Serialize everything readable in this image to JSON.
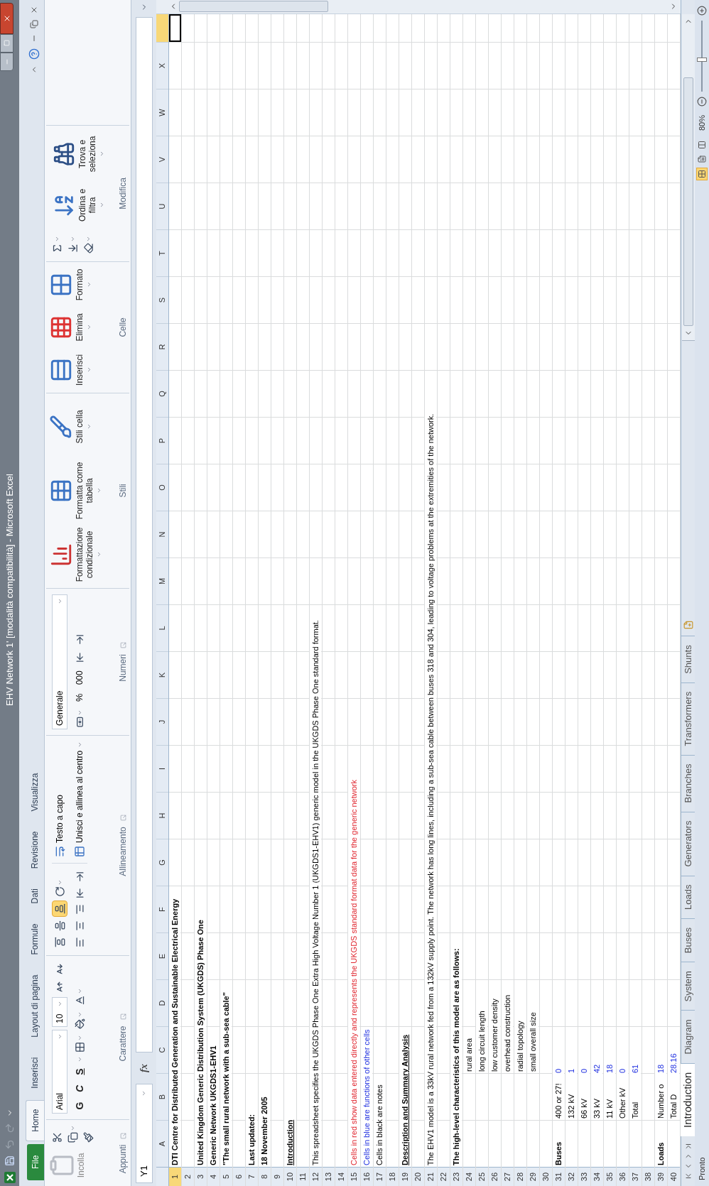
{
  "window": {
    "title": "EHV Network 1' [modalità compatibilità] - Microsoft Excel"
  },
  "menu_tabs": [
    {
      "label": "File",
      "kind": "file",
      "selected": false
    },
    {
      "label": "Home",
      "kind": "tab",
      "selected": true
    },
    {
      "label": "Inserisci",
      "kind": "tab",
      "selected": false
    },
    {
      "label": "Layout di pagina",
      "kind": "tab",
      "selected": false
    },
    {
      "label": "Formule",
      "kind": "tab",
      "selected": false
    },
    {
      "label": "Dati",
      "kind": "tab",
      "selected": false
    },
    {
      "label": "Revisione",
      "kind": "tab",
      "selected": false
    },
    {
      "label": "Visualizza",
      "kind": "tab",
      "selected": false
    }
  ],
  "ribbon": {
    "groups": [
      {
        "kind": "clipboard",
        "label": "Appunti",
        "paste": "Incolla"
      },
      {
        "kind": "font",
        "label": "Carattere",
        "font": "Arial",
        "size": "10",
        "styles": [
          "G",
          "C",
          "S"
        ]
      },
      {
        "kind": "alignment",
        "label": "Allineamento",
        "wrap": "Testo a capo",
        "merge": "Unisci e allinea al centro",
        "vertical": [
          {
            "selected": false
          },
          {
            "selected": false
          },
          {
            "selected": true
          }
        ]
      },
      {
        "kind": "number",
        "label": "Numeri",
        "format": "Generale",
        "percent": "%",
        "thousands": "000"
      },
      {
        "kind": "large",
        "label": "Stili",
        "buttons": [
          {
            "label": "Formattazione condizionale"
          },
          {
            "label": "Formatta come tabella"
          },
          {
            "label": "Stili cella"
          }
        ]
      },
      {
        "kind": "large",
        "label": "Celle",
        "buttons": [
          {
            "label": "Inserisci"
          },
          {
            "label": "Elimina"
          },
          {
            "label": "Formato"
          }
        ]
      },
      {
        "kind": "editing",
        "label": "Modifica",
        "buttons": [
          {
            "label": "Ordina e filtra"
          },
          {
            "label": "Trova e seleziona"
          }
        ]
      }
    ]
  },
  "formula_bar": {
    "name_box": "Y1",
    "function_label": "fx"
  },
  "sheet": {
    "columns": [
      {
        "label": "A"
      },
      {
        "label": "B"
      },
      {
        "label": "C"
      },
      {
        "label": "D"
      },
      {
        "label": "E"
      },
      {
        "label": "F"
      },
      {
        "label": "G"
      },
      {
        "label": "H"
      },
      {
        "label": "I"
      },
      {
        "label": "J"
      },
      {
        "label": "K"
      },
      {
        "label": "L"
      },
      {
        "label": "M"
      },
      {
        "label": "N"
      },
      {
        "label": "O"
      },
      {
        "label": "P"
      },
      {
        "label": "Q"
      },
      {
        "label": "R"
      },
      {
        "label": "S"
      },
      {
        "label": "T"
      },
      {
        "label": "U"
      },
      {
        "label": "V"
      },
      {
        "label": "W"
      },
      {
        "label": "X"
      }
    ],
    "partial_column_selected": true,
    "rows": [
      {
        "number": "1",
        "selected": true,
        "A": {
          "text": "DTI Centre for Distributed Generation and Sustainable Electrical Energy",
          "kind": "bold"
        }
      },
      {
        "number": "2",
        "selected": false
      },
      {
        "number": "3",
        "selected": false,
        "A": {
          "text": "United Kingdom Generic Distribution System (UKGDS) Phase One",
          "kind": "bold"
        }
      },
      {
        "number": "4",
        "selected": false,
        "A": {
          "text": "Generic Network UKGDS1-EHV1",
          "kind": "bold"
        }
      },
      {
        "number": "5",
        "selected": false,
        "A": {
          "text": "\"The small rural network with a sub-sea cable\"",
          "kind": "bold"
        }
      },
      {
        "number": "6",
        "selected": false
      },
      {
        "number": "7",
        "selected": false,
        "A": {
          "text": "Last updated:",
          "kind": "bold"
        }
      },
      {
        "number": "8",
        "selected": false,
        "A": {
          "text": "18 November 2005",
          "kind": "bold"
        }
      },
      {
        "number": "9",
        "selected": false
      },
      {
        "number": "10",
        "selected": false,
        "A": {
          "text": "Introduction",
          "kind": "heading"
        }
      },
      {
        "number": "11",
        "selected": false
      },
      {
        "number": "12",
        "selected": false,
        "A": {
          "text": "This spreadsheet specifies the UKGDS Phase One Extra High Voltage Number 1 (UKGDS1-EHV1) generic model in the UKGDS Phase One standard format.",
          "kind": "note"
        }
      },
      {
        "number": "13",
        "selected": false
      },
      {
        "number": "14",
        "selected": false
      },
      {
        "number": "15",
        "selected": false,
        "A": {
          "text": "Cells in red show data entered directly and represents the UKGDS standard format data for the generic network",
          "kind": "input"
        }
      },
      {
        "number": "16",
        "selected": false,
        "A": {
          "text": "Cells in blue are functions of other cells",
          "kind": "formula"
        }
      },
      {
        "number": "17",
        "selected": false,
        "A": {
          "text": "Cells in black are notes",
          "kind": "note"
        }
      },
      {
        "number": "18",
        "selected": false
      },
      {
        "number": "19",
        "selected": false,
        "A": {
          "text": "Description and Summary Analysis",
          "kind": "heading"
        }
      },
      {
        "number": "20",
        "selected": false
      },
      {
        "number": "21",
        "selected": false,
        "A": {
          "text": "The EHV1 model is a 33kV rural network fed from a 132kV supply point.  The network has long lines, including a sub-sea cable between buses 318 and 304, leading to voltage problems at the extremities of the network.",
          "kind": "note"
        }
      },
      {
        "number": "22",
        "selected": false
      },
      {
        "number": "23",
        "selected": false,
        "A": {
          "text": "The high-level characteristics of this model are as follows:",
          "kind": "bold"
        }
      },
      {
        "number": "24",
        "selected": false,
        "C": {
          "text": "rural area",
          "kind": "note"
        }
      },
      {
        "number": "25",
        "selected": false,
        "C": {
          "text": "long circuit length",
          "kind": "note"
        }
      },
      {
        "number": "26",
        "selected": false,
        "C": {
          "text": "low customer density",
          "kind": "note"
        }
      },
      {
        "number": "27",
        "selected": false,
        "C": {
          "text": "overhead construction",
          "kind": "note"
        }
      },
      {
        "number": "28",
        "selected": false,
        "C": {
          "text": "radial topology",
          "kind": "note"
        }
      },
      {
        "number": "29",
        "selected": false,
        "C": {
          "text": "small overall size",
          "kind": "note"
        }
      },
      {
        "number": "30",
        "selected": false
      },
      {
        "number": "31",
        "selected": false,
        "A": {
          "text": "Buses",
          "kind": "bold"
        },
        "B": {
          "text": "400 or 27!",
          "kind": "note"
        },
        "C": {
          "text": "0",
          "kind": "number"
        }
      },
      {
        "number": "32",
        "selected": false,
        "B": {
          "text": "132 kV",
          "kind": "note"
        },
        "C": {
          "text": "1",
          "kind": "number"
        }
      },
      {
        "number": "33",
        "selected": false,
        "B": {
          "text": "66 kV",
          "kind": "note"
        },
        "C": {
          "text": "0",
          "kind": "number"
        }
      },
      {
        "number": "34",
        "selected": false,
        "B": {
          "text": "33 kV",
          "kind": "note"
        },
        "C": {
          "text": "42",
          "kind": "number"
        }
      },
      {
        "number": "35",
        "selected": false,
        "B": {
          "text": "11 kV",
          "kind": "note"
        },
        "C": {
          "text": "18",
          "kind": "number"
        }
      },
      {
        "number": "36",
        "selected": false,
        "B": {
          "text": "Other kV",
          "kind": "note"
        },
        "C": {
          "text": "0",
          "kind": "number"
        }
      },
      {
        "number": "37",
        "selected": false,
        "B": {
          "text": "Total",
          "kind": "note"
        },
        "C": {
          "text": "61",
          "kind": "number"
        }
      },
      {
        "number": "38",
        "selected": false
      },
      {
        "number": "39",
        "selected": false,
        "A": {
          "text": "Loads",
          "kind": "bold"
        },
        "B": {
          "text": "Number o",
          "kind": "note"
        },
        "C": {
          "text": "18",
          "kind": "number"
        }
      },
      {
        "number": "40",
        "selected": false,
        "B": {
          "text": "Total D",
          "kind": "note"
        },
        "C": {
          "text": "28.16",
          "kind": "number"
        }
      }
    ]
  },
  "sheet_tabs": [
    {
      "label": "Introduction",
      "selected": true
    },
    {
      "label": "Diagram",
      "selected": false
    },
    {
      "label": "System",
      "selected": false
    },
    {
      "label": "Buses",
      "selected": false
    },
    {
      "label": "Loads",
      "selected": false
    },
    {
      "label": "Generators",
      "selected": false
    },
    {
      "label": "Branches",
      "selected": false
    },
    {
      "label": "Transformers",
      "selected": false
    },
    {
      "label": "Shunts",
      "selected": false
    }
  ],
  "status_bar": {
    "text": "Pronto",
    "views": [
      {
        "selected": true
      },
      {
        "selected": false
      },
      {
        "selected": false
      }
    ],
    "zoom": "80%",
    "zoom_slider": {
      "level": 0.45
    }
  }
}
